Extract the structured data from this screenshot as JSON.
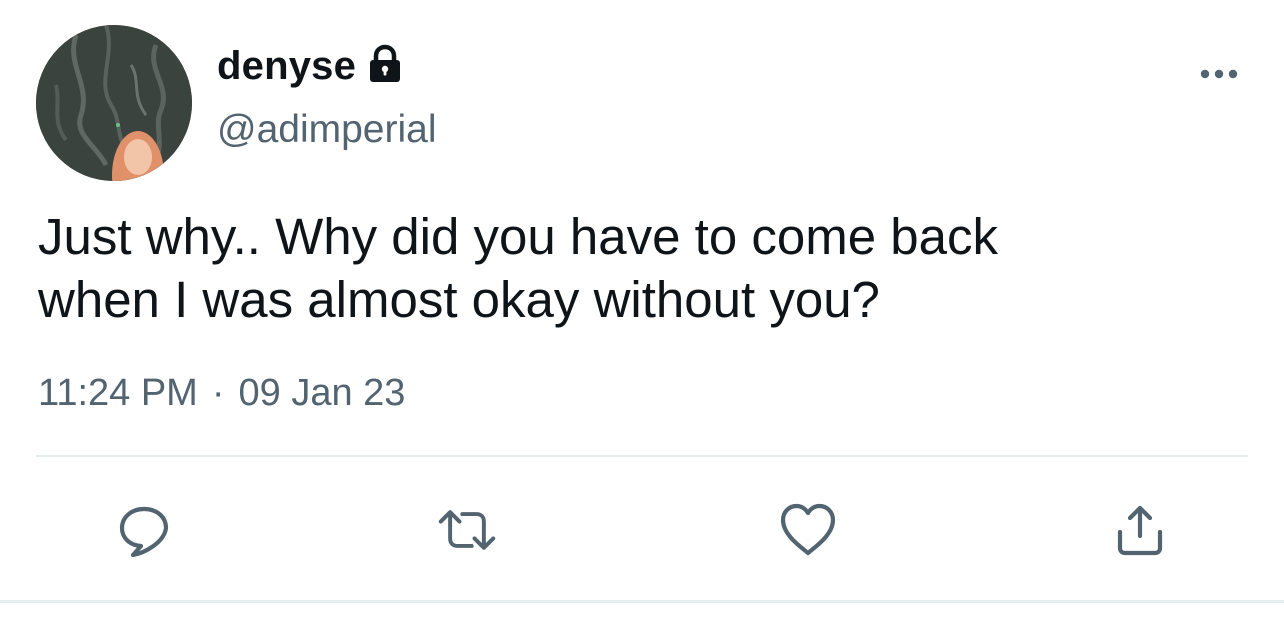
{
  "tweet": {
    "author": {
      "display_name": "denyse",
      "handle": "@adimperial",
      "protected_icon": "lock-icon"
    },
    "more_icon": "more-horizontal-icon",
    "text": "Just why.. Why did you have to come back\nwhen I was almost okay without you?",
    "time": "11:24 PM",
    "separator": "·",
    "date": "09 Jan 23"
  },
  "actions": [
    {
      "name": "reply",
      "icon": "reply-icon"
    },
    {
      "name": "retweet",
      "icon": "retweet-icon"
    },
    {
      "name": "like",
      "icon": "heart-icon"
    },
    {
      "name": "share",
      "icon": "share-icon"
    }
  ],
  "colors": {
    "text_primary": "#0f1419",
    "text_secondary": "#536471",
    "divider": "#e6ecf0",
    "background": "#ffffff"
  }
}
